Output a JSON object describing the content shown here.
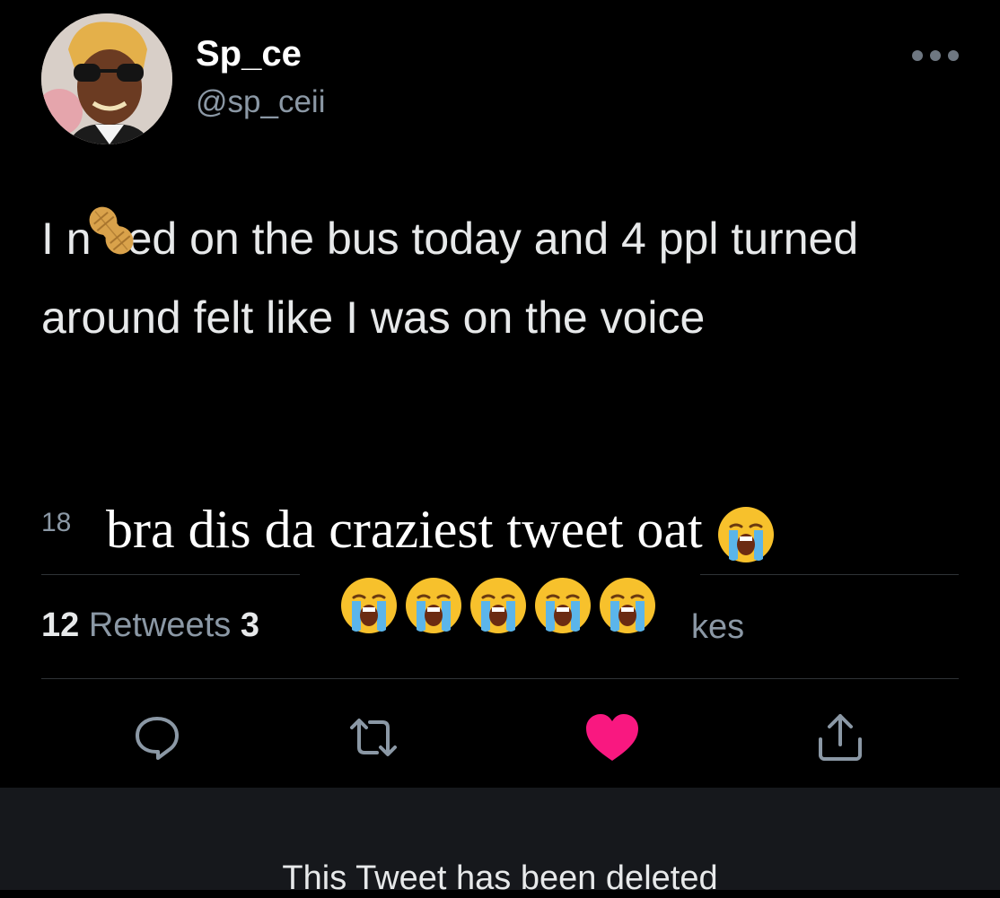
{
  "tweet": {
    "display_name": "Sp_ce",
    "handle": "@sp_ceii",
    "text_part1": "I n",
    "text_part2": "ed on the bus today and 4 ppl turned around felt like I was on the voice",
    "time_partial": "18",
    "stats": {
      "retweets_count": "12",
      "retweets_label": "Retweets",
      "quote_partial": "3",
      "likes_partial": "kes"
    },
    "deleted_notice": "This Tweet has been deleted"
  },
  "caption": {
    "line1": "bra dis da craziest tweet oat",
    "emoji_name": "loudly-crying-face"
  },
  "colors": {
    "background": "#000000",
    "text": "#e7e9ea",
    "secondary_text": "#8b98a5",
    "like_red": "#f91880",
    "divider": "#2f3336",
    "deleted_box": "#16181c"
  },
  "icons": {
    "more": "more-horizontal-icon",
    "reply": "reply-icon",
    "retweet": "retweet-icon",
    "like": "heart-filled-icon",
    "share": "share-icon",
    "inline_emoji": "peanut-emoji"
  }
}
